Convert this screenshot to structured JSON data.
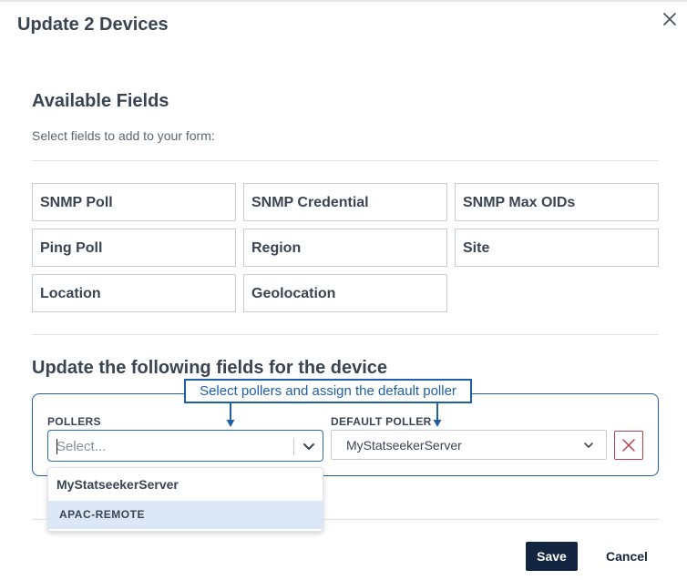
{
  "dialog": {
    "title": "Update 2 Devices"
  },
  "available": {
    "title": "Available Fields",
    "subtitle": "Select fields to add to your form:",
    "fields": [
      "SNMP Poll",
      "SNMP Credential",
      "SNMP Max OIDs",
      "Ping Poll",
      "Region",
      "Site",
      "Location",
      "Geolocation"
    ]
  },
  "update": {
    "title": "Update the following fields for the device",
    "tooltip": "Select pollers and assign the default poller",
    "pollers_label": "POLLERS",
    "pollers_placeholder": "Select...",
    "pollers_value": "",
    "default_poller_label": "DEFAULT POLLER",
    "default_poller_value": "MyStatseekerServer",
    "options": [
      "MyStatseekerServer",
      "APAC-REMOTE"
    ]
  },
  "footer": {
    "save_label": "Save",
    "cancel_label": "Cancel"
  },
  "colors": {
    "accent": "#1f5fa8",
    "primary_button": "#12243f",
    "danger": "#b8404a",
    "option_highlight": "#dce8f8"
  },
  "icons": {
    "close": "close-icon",
    "chevron": "chevron-down-icon",
    "remove": "remove-x-icon"
  }
}
